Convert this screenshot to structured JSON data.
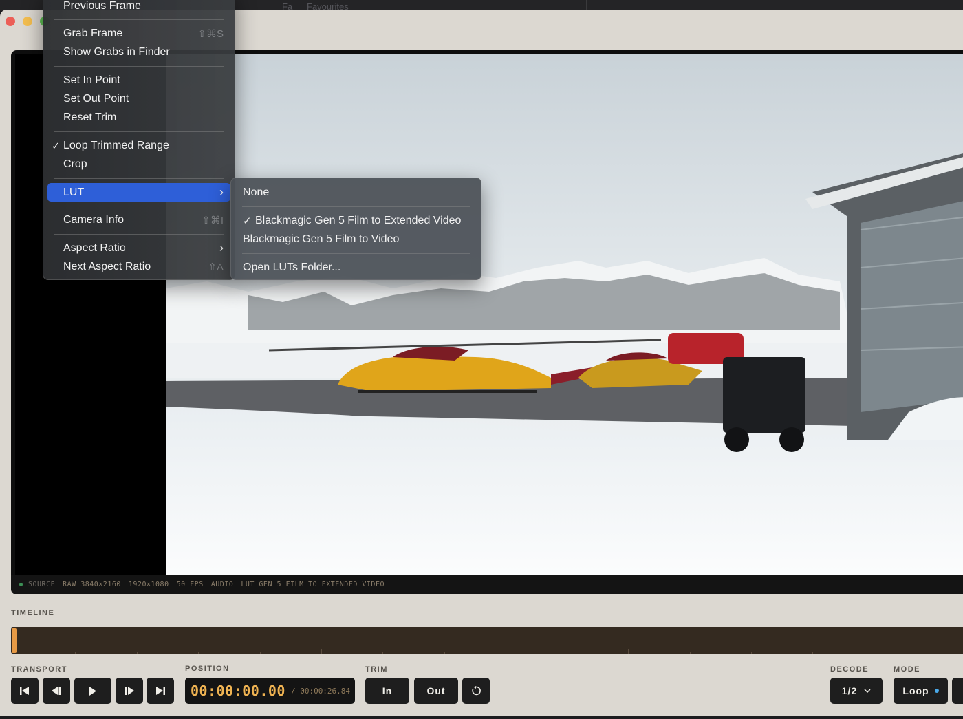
{
  "background_tabs": {
    "tab1": "Fa",
    "tab2": "Favourites"
  },
  "menu": {
    "items": [
      {
        "label": "Previous Frame"
      },
      {
        "label": "Grab Frame",
        "shortcut": "⇧⌘S"
      },
      {
        "label": "Show Grabs in Finder"
      },
      {
        "label": "Set In Point"
      },
      {
        "label": "Set Out Point"
      },
      {
        "label": "Reset Trim"
      },
      {
        "label": "Loop Trimmed Range",
        "checked": true
      },
      {
        "label": "Crop"
      },
      {
        "label": "LUT",
        "has_submenu": true,
        "highlighted": true
      },
      {
        "label": "Camera Info",
        "shortcut": "⇧⌘I"
      },
      {
        "label": "Aspect Ratio",
        "has_submenu": true
      },
      {
        "label": "Next Aspect Ratio",
        "shortcut": "⇧A"
      }
    ],
    "check_mark": "✓",
    "submenu_chevron": "›"
  },
  "lut_submenu": {
    "items": [
      {
        "label": "None"
      },
      {
        "label": "Blackmagic Gen 5 Film to Extended Video",
        "checked": true
      },
      {
        "label": "Blackmagic Gen 5 Film to Video"
      },
      {
        "label": "Open LUTs Folder..."
      }
    ]
  },
  "info_bar": {
    "source": "SOURCE",
    "raw": "RAW 3840×2160",
    "resolution": "1920×1080",
    "fps": "50 FPS",
    "audio": "AUDIO",
    "lut": "LUT GEN 5 FILM TO EXTENDED VIDEO"
  },
  "timeline": {
    "label": "TIMELINE",
    "playhead_fraction": 0.0
  },
  "transport": {
    "label": "TRANSPORT",
    "buttons": [
      "skip-to-start",
      "step-back",
      "play",
      "step-forward",
      "skip-to-end"
    ]
  },
  "position": {
    "label": "POSITION",
    "current": "00:00:00.00",
    "total": "/ 00:00:26.84"
  },
  "trim": {
    "label": "TRIM",
    "in_label": "In",
    "out_label": "Out",
    "reset_icon": "reset-icon"
  },
  "decode": {
    "label": "DECODE",
    "value": "1/2"
  },
  "mode": {
    "label": "MODE",
    "value": "Loop"
  },
  "colors": {
    "window_bg": "#dcd8d1",
    "timeline_bg": "#342a20",
    "playhead": "#e79a45",
    "timecode": "#efb352",
    "menu_highlight": "#2e5fd8",
    "mode_dot": "#4aa9e9"
  }
}
